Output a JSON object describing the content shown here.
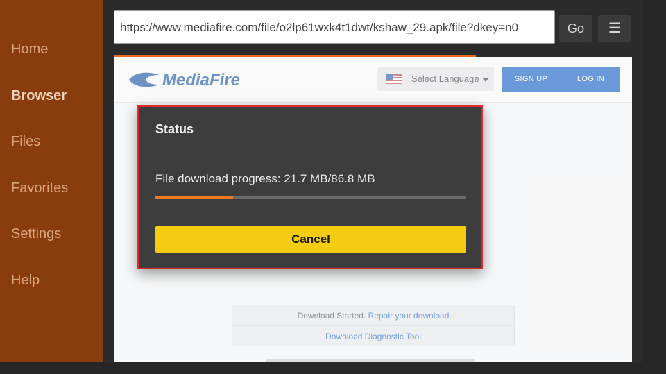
{
  "sidebar": {
    "items": [
      {
        "label": "Home",
        "active": false
      },
      {
        "label": "Browser",
        "active": true
      },
      {
        "label": "Files",
        "active": false
      },
      {
        "label": "Favorites",
        "active": false
      },
      {
        "label": "Settings",
        "active": false
      },
      {
        "label": "Help",
        "active": false
      }
    ]
  },
  "toolbar": {
    "url": "https://www.mediafire.com/file/o2lp61wxk4t1dwt/kshaw_29.apk/file?dkey=n0",
    "go_label": "Go",
    "menu_icon": "hamburger-icon"
  },
  "webpage": {
    "logo_text": "MediaFire",
    "language_label": "Select Language",
    "signup_label": "SIGN UP",
    "login_label": "LOG IN",
    "download_started": "Download Started.",
    "repair_link": "Repair your download",
    "diagnostic_link": "Download Diagnostic Tool"
  },
  "dialog": {
    "title": "Status",
    "progress_label": "File download progress: 21.7 MB/86.8 MB",
    "progress_fraction": 0.25,
    "cancel_label": "Cancel"
  },
  "colors": {
    "sidebar_bg": "#8a3d0c",
    "accent_orange": "#f07a23",
    "cancel_yellow": "#f5cc0f",
    "dialog_border": "#e02a2a",
    "mediafire_blue": "#1f5aa8"
  }
}
